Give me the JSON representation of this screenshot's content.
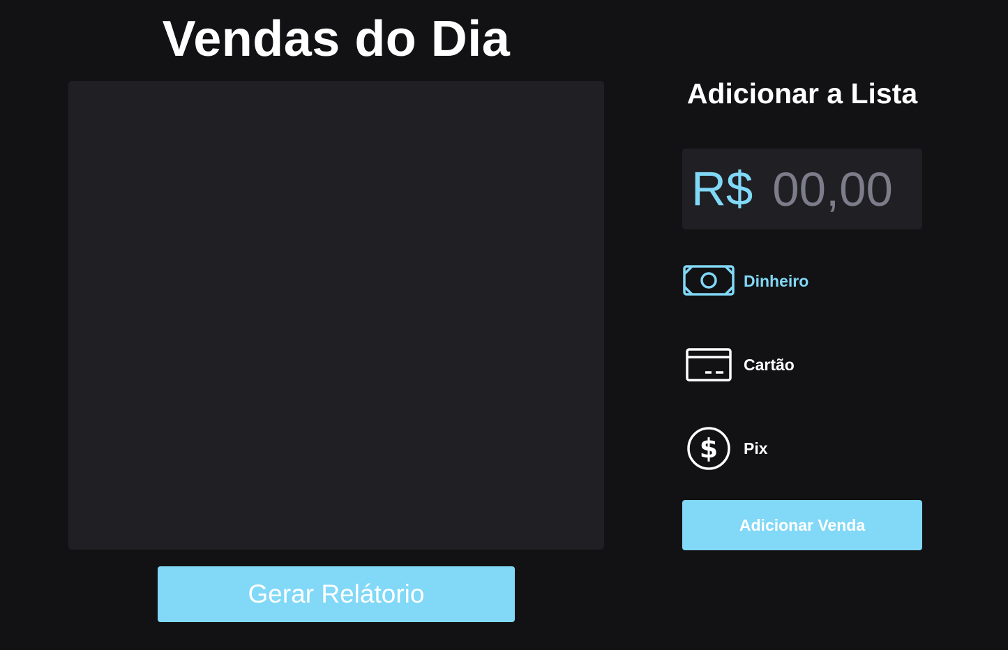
{
  "sales": {
    "title": "Vendas do Dia",
    "report_button_label": "Gerar Relátorio"
  },
  "add_form": {
    "title": "Adicionar a Lista",
    "currency_symbol": "R$",
    "amount_placeholder": "00,00",
    "payment_methods": [
      {
        "label": "Dinheiro",
        "icon": "cash-icon",
        "selected": true
      },
      {
        "label": "Cartão",
        "icon": "credit-card-icon",
        "selected": false
      },
      {
        "label": "Pix",
        "icon": "dollar-circle-icon",
        "selected": false
      }
    ],
    "submit_label": "Adicionar Venda"
  },
  "colors": {
    "background": "#121214",
    "panel": "#202024",
    "accent": "#81d8f7",
    "placeholder": "#7c7c8a",
    "text": "#ffffff"
  }
}
